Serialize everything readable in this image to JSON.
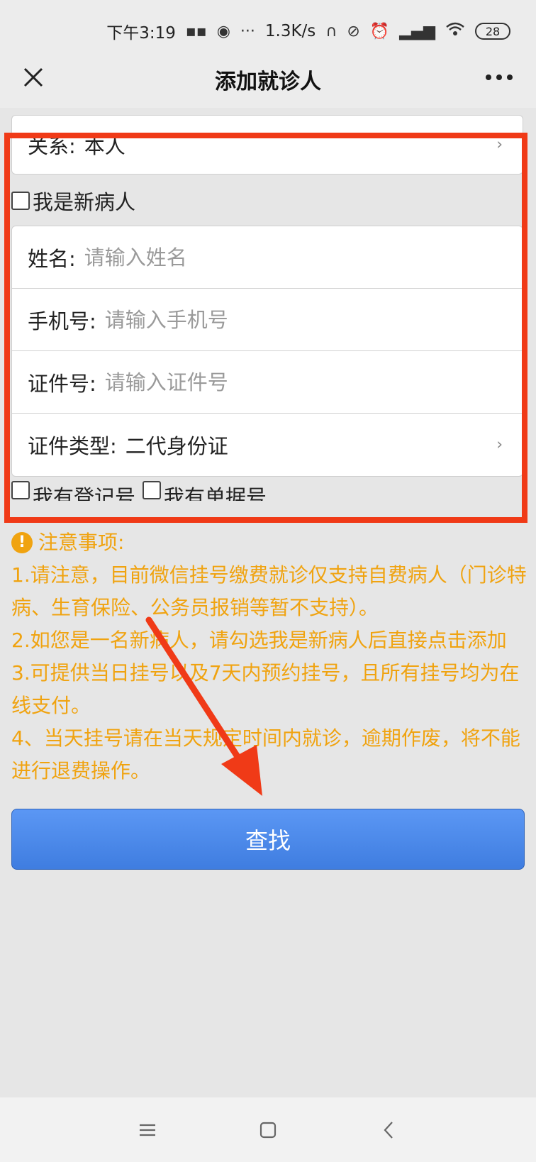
{
  "status_bar": {
    "time": "下午3:19",
    "speed": "1.3K/s",
    "battery": "28",
    "icons": [
      "message-icon",
      "message-icon",
      "weibo-icon",
      "more-dots-icon",
      "headset-icon",
      "mute-icon",
      "alarm-icon",
      "signal-hd-icon",
      "signal-hd-icon",
      "wifi-icon"
    ]
  },
  "header": {
    "title": "添加就诊人",
    "close_icon": "close-icon",
    "more_icon": "more-icon"
  },
  "form": {
    "relation_label": "关系:",
    "relation_value": "本人",
    "new_patient_label": "我是新病人",
    "name_label": "姓名:",
    "name_placeholder": "请输入姓名",
    "phone_label": "手机号:",
    "phone_placeholder": "请输入手机号",
    "id_label": "证件号:",
    "id_placeholder": "请输入证件号",
    "id_type_label": "证件类型:",
    "id_type_value": "二代身份证",
    "reg_no_label": "我有登记号",
    "receipt_no_label": "我有单据号"
  },
  "notice": {
    "title": "注意事项:",
    "items": [
      "1.请注意，目前微信挂号缴费就诊仅支持自费病人（门诊特病、生育保险、公务员报销等暂不支持）。",
      "2.如您是一名新病人，请勾选我是新病人后直接点击添加",
      "3.可提供当日挂号以及7天内预约挂号，且所有挂号均为在线支付。",
      "4、当天挂号请在当天规定时间内就诊，逾期作废，将不能进行退费操作。"
    ]
  },
  "actions": {
    "search_label": "查找"
  },
  "colors": {
    "highlight": "#f03a17",
    "notice": "#f0a310",
    "button": "#4a88ea"
  }
}
